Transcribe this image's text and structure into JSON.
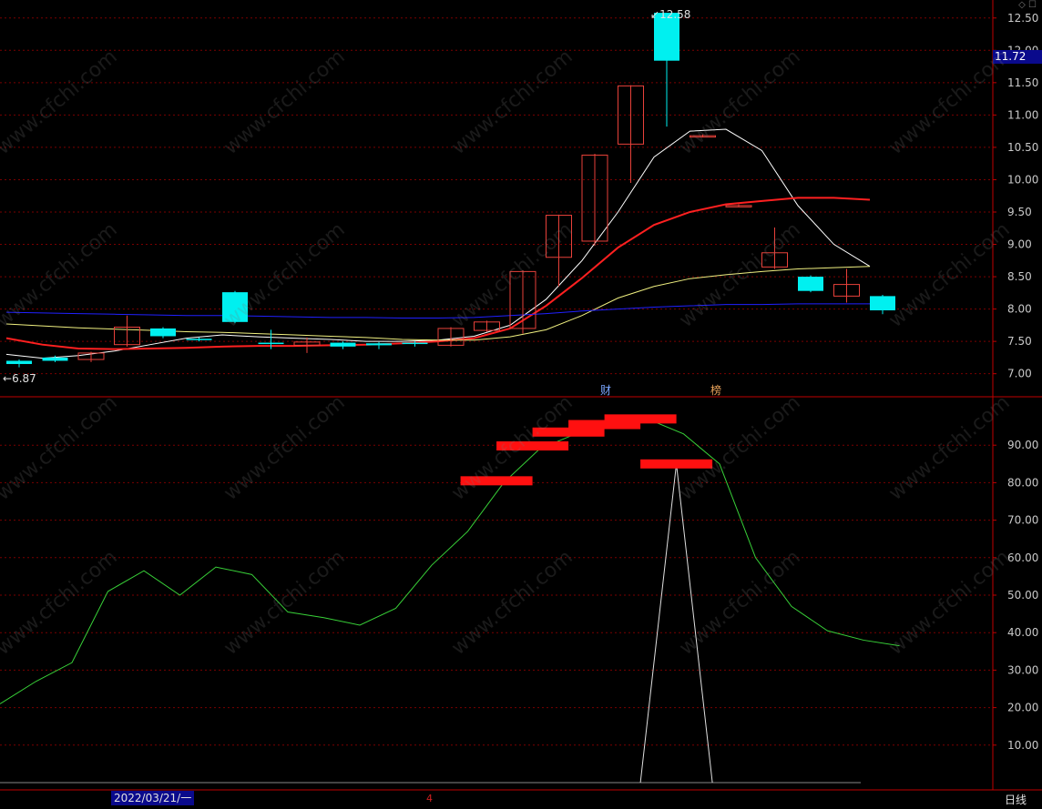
{
  "watermark": "www.cfchi.com",
  "labels": {
    "current_price": "11.72",
    "high_price": "12.58",
    "low_price": "6.87",
    "date": "2022/03/21/一",
    "x_tick": "4",
    "period": "日线",
    "marker_cai": "财",
    "marker_bang": "榜"
  },
  "colors": {
    "background": "#000000",
    "up": "#e8413a",
    "down": "#00f0f0",
    "ma_white": "#ffffff",
    "ma_red": "#ff2020",
    "ma_yellow": "#f0f080",
    "ma_blue": "#2020ff",
    "indicator": "#38d038",
    "grid": "#7a0000"
  },
  "chart_data": [
    {
      "type": "candlestick",
      "ylim": [
        6.7,
        12.75
      ],
      "y_ticks": [
        "12.50",
        "12.00",
        "11.50",
        "11.00",
        "10.50",
        "10.00",
        "9.50",
        "9.00",
        "8.50",
        "8.00",
        "7.50",
        "7.00"
      ],
      "candles": [
        {
          "open": 7.2,
          "close": 7.15,
          "high": 7.22,
          "low": 7.1
        },
        {
          "open": 7.25,
          "close": 7.2,
          "high": 7.28,
          "low": 7.18
        },
        {
          "open": 7.22,
          "close": 7.32,
          "high": 7.34,
          "low": 7.18
        },
        {
          "open": 7.45,
          "close": 7.72,
          "high": 7.9,
          "low": 7.42
        },
        {
          "open": 7.7,
          "close": 7.58,
          "high": 7.72,
          "low": 7.55
        },
        {
          "open": 7.54,
          "close": 7.52,
          "high": 7.56,
          "low": 7.5
        },
        {
          "open": 8.26,
          "close": 7.8,
          "high": 8.28,
          "low": 7.78
        },
        {
          "open": 7.48,
          "close": 7.47,
          "high": 7.68,
          "low": 7.38
        },
        {
          "open": 7.44,
          "close": 7.49,
          "high": 7.56,
          "low": 7.32
        },
        {
          "open": 7.48,
          "close": 7.42,
          "high": 7.5,
          "low": 7.38
        },
        {
          "open": 7.47,
          "close": 7.44,
          "high": 7.49,
          "low": 7.38
        },
        {
          "open": 7.48,
          "close": 7.47,
          "high": 7.5,
          "low": 7.42
        },
        {
          "open": 7.44,
          "close": 7.7,
          "high": 7.72,
          "low": 7.42
        },
        {
          "open": 7.67,
          "close": 7.8,
          "high": 7.82,
          "low": 7.65
        },
        {
          "open": 7.7,
          "close": 8.58,
          "high": 8.6,
          "low": 7.62
        },
        {
          "open": 8.8,
          "close": 9.45,
          "high": 9.46,
          "low": 8.35
        },
        {
          "open": 9.05,
          "close": 10.38,
          "high": 10.4,
          "low": 8.98
        },
        {
          "open": 10.55,
          "close": 11.45,
          "high": 11.46,
          "low": 9.95
        },
        {
          "open": 12.58,
          "close": 11.84,
          "high": 12.58,
          "low": 10.82
        },
        {
          "open": 10.68,
          "close": 10.68,
          "high": 10.7,
          "low": 10.66
        },
        {
          "open": 9.6,
          "close": 9.6,
          "high": 9.62,
          "low": 9.58
        },
        {
          "open": 8.65,
          "close": 8.87,
          "high": 9.26,
          "low": 8.62
        },
        {
          "open": 8.5,
          "close": 8.28,
          "high": 8.52,
          "low": 8.26
        },
        {
          "open": 8.2,
          "close": 8.38,
          "high": 8.62,
          "low": 8.1
        },
        {
          "open": 8.2,
          "close": 7.98,
          "high": 8.22,
          "low": 7.92
        }
      ],
      "ma": [
        {
          "color": "#ffffff",
          "values": [
            7.3,
            7.24,
            7.28,
            7.35,
            7.45,
            7.55,
            7.6,
            7.57,
            7.55,
            7.53,
            7.5,
            7.5,
            7.52,
            7.58,
            7.75,
            8.15,
            8.75,
            9.5,
            10.35,
            10.75,
            10.78,
            10.45,
            9.6,
            9.0,
            8.66
          ]
        },
        {
          "color": "#ff2020",
          "values": [
            7.55,
            7.45,
            7.39,
            7.38,
            7.39,
            7.4,
            7.42,
            7.43,
            7.43,
            7.44,
            7.45,
            7.47,
            7.5,
            7.55,
            7.7,
            8.05,
            8.48,
            8.95,
            9.3,
            9.5,
            9.62,
            9.67,
            9.72,
            9.72,
            9.69
          ]
        },
        {
          "color": "#f0f080",
          "values": [
            7.77,
            7.74,
            7.71,
            7.69,
            7.67,
            7.65,
            7.64,
            7.62,
            7.6,
            7.58,
            7.56,
            7.53,
            7.52,
            7.52,
            7.57,
            7.68,
            7.9,
            8.17,
            8.35,
            8.47,
            8.53,
            8.58,
            8.62,
            8.64,
            8.66
          ]
        },
        {
          "color": "#2020ff",
          "values": [
            7.95,
            7.94,
            7.93,
            7.92,
            7.91,
            7.9,
            7.9,
            7.89,
            7.88,
            7.87,
            7.87,
            7.86,
            7.86,
            7.87,
            7.9,
            7.93,
            7.97,
            8.0,
            8.03,
            8.05,
            8.07,
            8.07,
            8.08,
            8.08,
            8.08
          ]
        }
      ]
    },
    {
      "type": "line",
      "ylim": [
        0,
        100
      ],
      "y_ticks": [
        "90.00",
        "80.00",
        "70.00",
        "60.00",
        "50.00",
        "40.00",
        "30.00",
        "20.00",
        "10.00"
      ],
      "series": [
        {
          "color": "#38d038",
          "values": [
            21,
            27,
            32,
            51,
            56.5,
            50,
            57.5,
            55.5,
            45.5,
            44,
            42,
            46.5,
            58,
            67,
            80,
            89,
            93,
            96,
            97,
            93,
            85,
            60,
            47,
            40.5,
            38,
            36.5
          ]
        }
      ],
      "signal_bars": [
        {
          "value": 80.5,
          "start": 12.8,
          "end": 14.8
        },
        {
          "value": 89.8,
          "start": 13.8,
          "end": 15.8
        },
        {
          "value": 93.5,
          "start": 14.8,
          "end": 16.8
        },
        {
          "value": 95.5,
          "start": 15.8,
          "end": 17.8
        },
        {
          "value": 97,
          "start": 16.8,
          "end": 18.8
        },
        {
          "value": 85,
          "start": 17.8,
          "end": 19.8
        }
      ],
      "spike": {
        "base": 0,
        "peak": 85,
        "from": 17.8,
        "apex": 18.8,
        "to": 19.8
      }
    }
  ]
}
